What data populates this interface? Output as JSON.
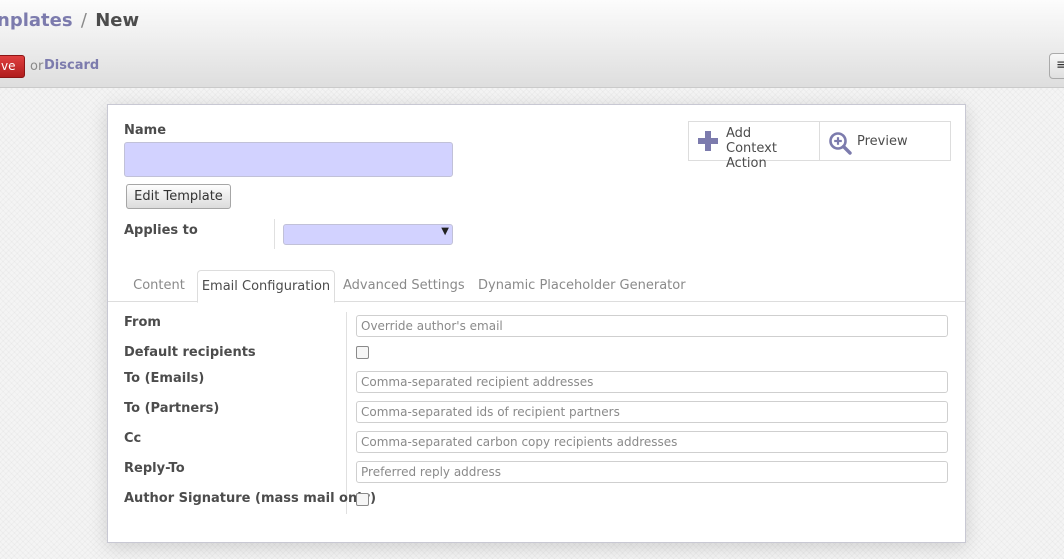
{
  "breadcrumb": {
    "parent": "nplates",
    "separator": "/",
    "current": "New"
  },
  "toolbar": {
    "save_label": "ve",
    "or_text": "or",
    "discard_label": "Discard",
    "menu_icon": "≡"
  },
  "form": {
    "name_label": "Name",
    "name_value": "",
    "edit_template_label": "Edit Template",
    "applies_to_label": "Applies to",
    "applies_to_value": ""
  },
  "button_box": {
    "add_context": {
      "line1": "Add",
      "line2": "Context Action",
      "icon": "plus-icon"
    },
    "preview": {
      "label": "Preview",
      "icon": "zoom-in-icon"
    }
  },
  "tabs": [
    {
      "label": "Content",
      "active": false
    },
    {
      "label": "Email Configuration",
      "active": true
    },
    {
      "label": "Advanced Settings",
      "active": false
    },
    {
      "label": "Dynamic Placeholder Generator",
      "active": false
    }
  ],
  "email_config": {
    "from": {
      "label": "From",
      "placeholder": "Override author's email"
    },
    "default_recipients": {
      "label": "Default recipients",
      "checked": false
    },
    "to_emails": {
      "label": "To (Emails)",
      "placeholder": "Comma-separated recipient addresses"
    },
    "to_partners": {
      "label": "To (Partners)",
      "placeholder": "Comma-separated ids of recipient partners"
    },
    "cc": {
      "label": "Cc",
      "placeholder": "Comma-separated carbon copy recipients addresses"
    },
    "reply_to": {
      "label": "Reply-To",
      "placeholder": "Preferred reply address"
    },
    "author_signature": {
      "label": "Author Signature (mass mail only)",
      "checked": false
    }
  },
  "colors": {
    "accent": "#7c7bad",
    "required_field": "#d2d2ff",
    "save_button": "#d12b2b"
  }
}
